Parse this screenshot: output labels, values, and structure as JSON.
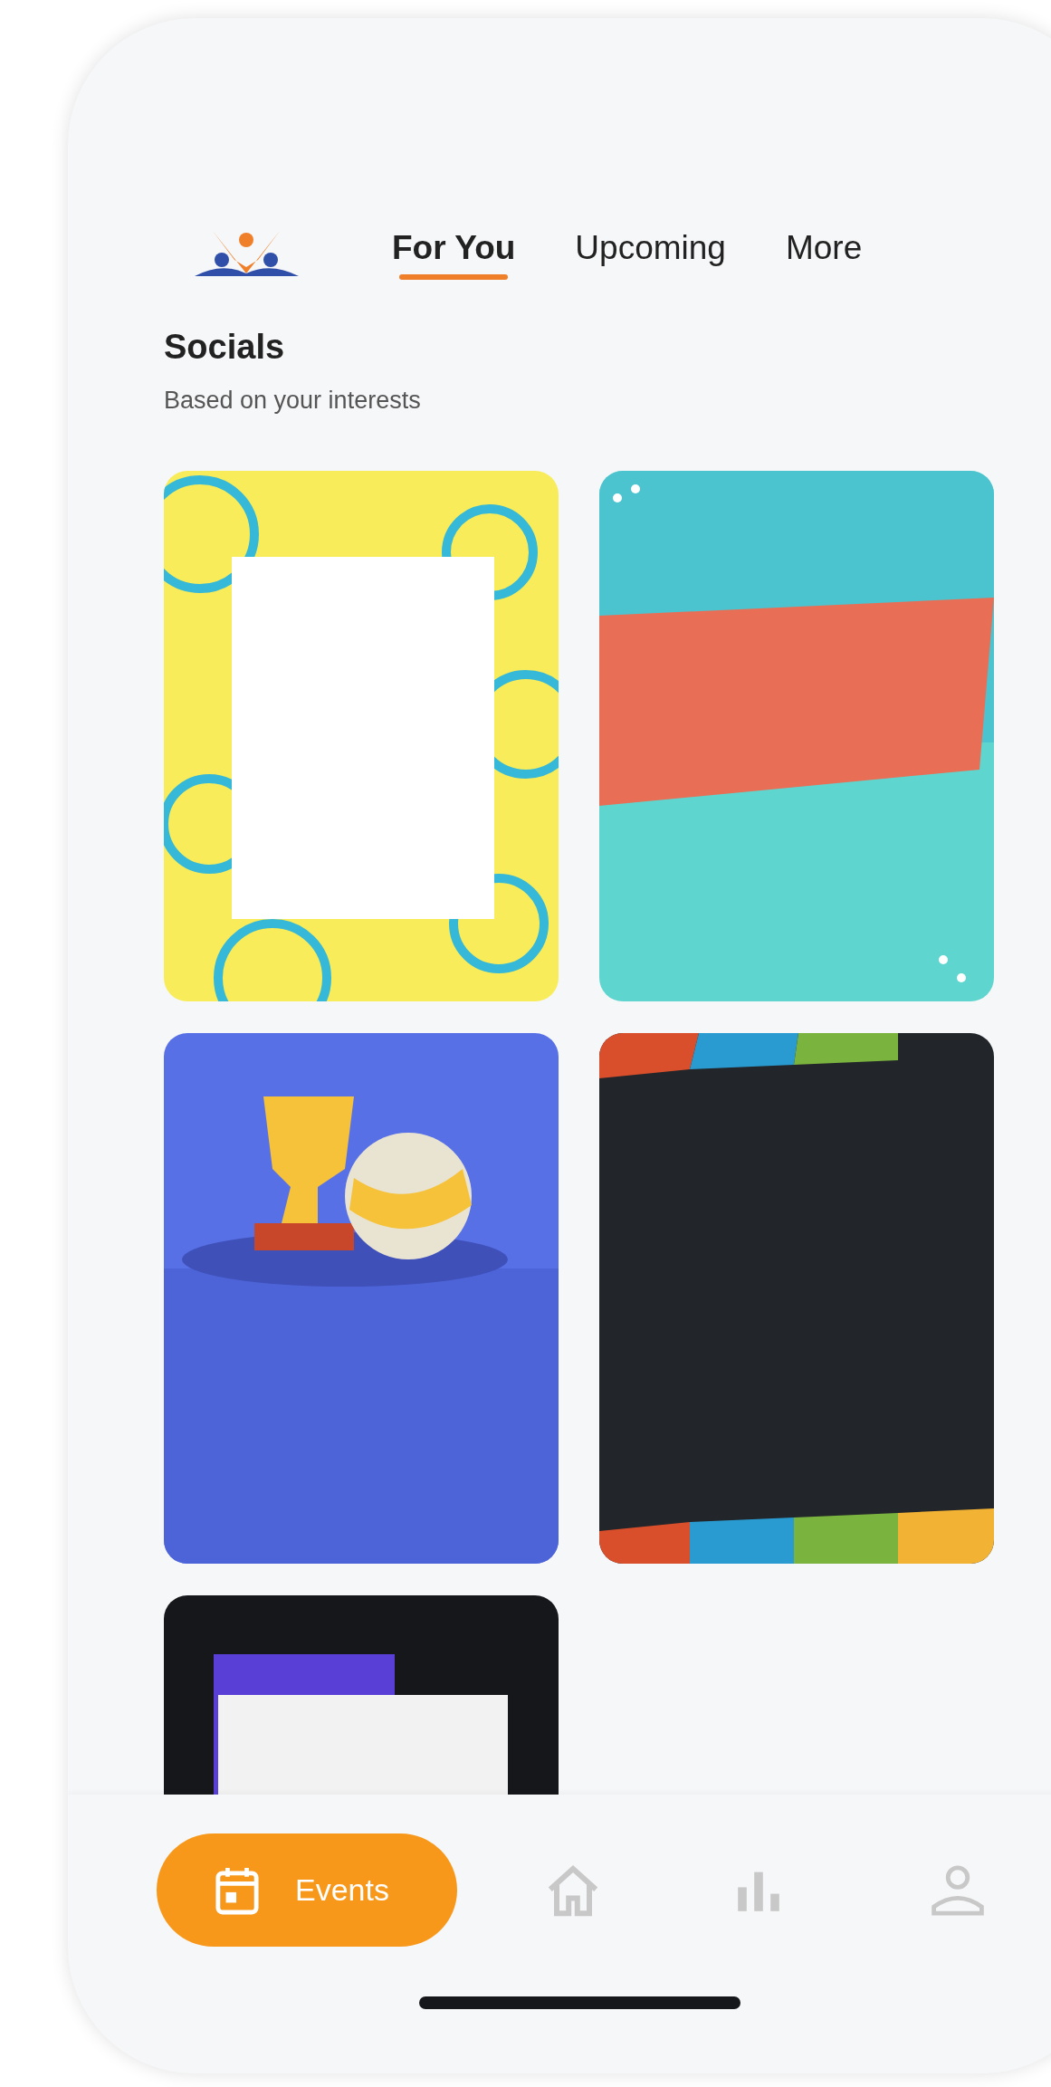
{
  "tabs": [
    {
      "label": "For You",
      "selected": true
    },
    {
      "label": "Upcoming",
      "selected": false
    },
    {
      "label": "More",
      "selected": false
    }
  ],
  "section": {
    "title": "Socials",
    "subtitle": "Based on your interests"
  },
  "bottom_nav": [
    {
      "label": "Events",
      "selected": true
    },
    {
      "selected": false
    },
    {
      "selected": false
    },
    {
      "selected": false
    }
  ]
}
